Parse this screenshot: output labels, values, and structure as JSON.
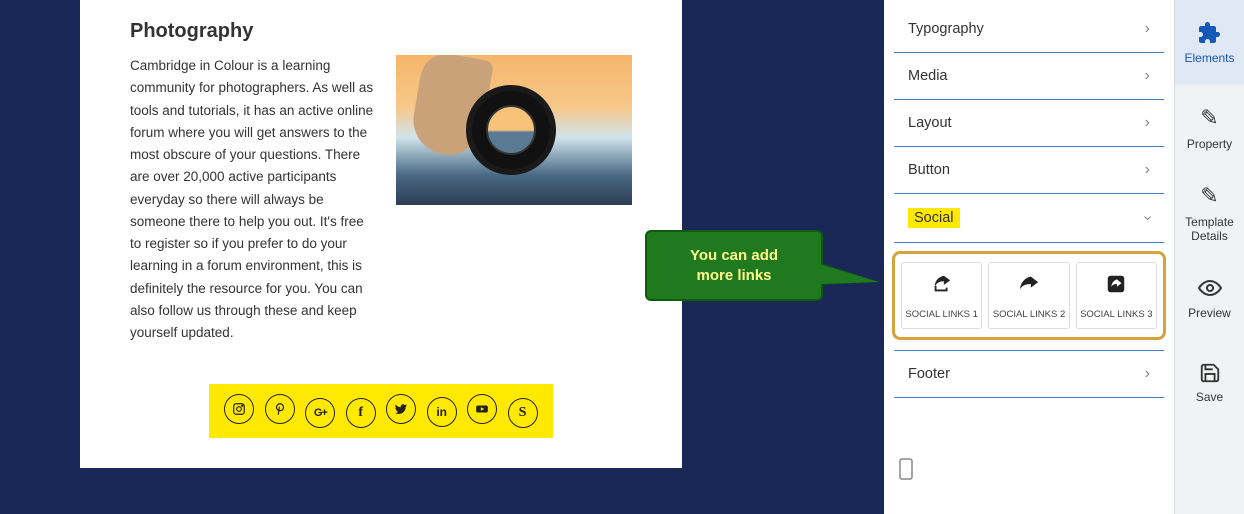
{
  "content": {
    "heading": "Photography",
    "body": "Cambridge in Colour is a learning community for photographers. As well as tools and tutorials, it has an active online forum where you will get answers to the most obscure of your questions. There are over 20,000 active participants everyday so there will always be someone there to help you out. It's free to register so if you prefer to do your learning in a forum environment, this is definitely the resource for you. You can also follow us through these and keep yourself updated."
  },
  "social_icons": [
    "instagram",
    "pinterest",
    "googleplus",
    "facebook",
    "twitter",
    "linkedin",
    "youtube",
    "skype"
  ],
  "callout": {
    "line1": "You can add",
    "line2": "more links"
  },
  "panel": {
    "sections": [
      "Typography",
      "Media",
      "Layout",
      "Button",
      "Social",
      "Footer"
    ],
    "social_tiles": [
      {
        "label": "SOCIAL LINKS 1",
        "iconname": "share-box-icon"
      },
      {
        "label": "SOCIAL LINKS 2",
        "iconname": "share-arrow-icon"
      },
      {
        "label": "SOCIAL LINKS 3",
        "iconname": "share-square-icon"
      }
    ]
  },
  "toolbar": {
    "elements": "Elements",
    "property": "Property",
    "template": "Template Details",
    "preview": "Preview",
    "save": "Save"
  }
}
